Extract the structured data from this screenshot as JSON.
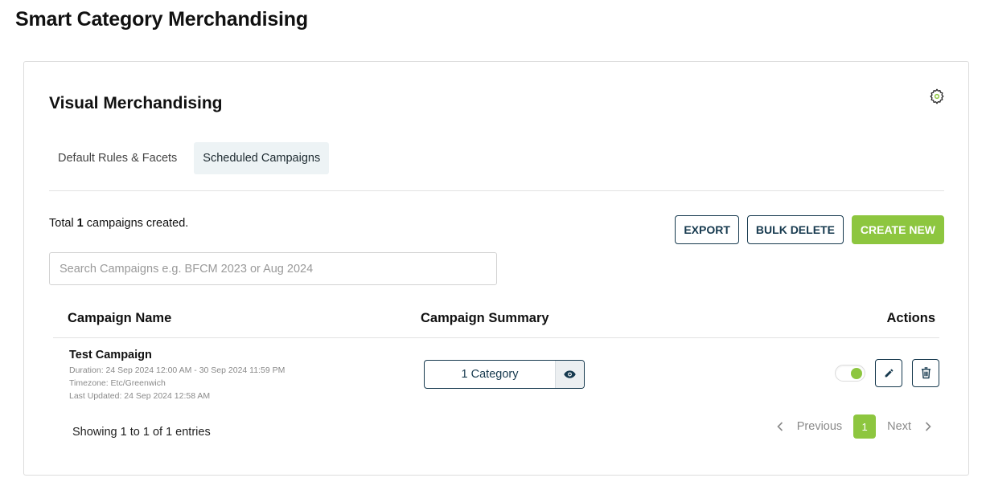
{
  "page": {
    "title": "Smart Category Merchandising"
  },
  "card": {
    "title": "Visual Merchandising",
    "settings_icon": "gear-icon"
  },
  "tabs": [
    {
      "label": "Default Rules & Facets",
      "active": false
    },
    {
      "label": "Scheduled Campaigns",
      "active": true
    }
  ],
  "summary": {
    "prefix": "Total",
    "count": "1",
    "suffix": "campaigns created."
  },
  "toolbar": {
    "export_label": "EXPORT",
    "bulk_delete_label": "BULK DELETE",
    "create_new_label": "CREATE NEW"
  },
  "search": {
    "placeholder": "Search Campaigns e.g. BFCM 2023 or Aug 2024",
    "value": ""
  },
  "table": {
    "columns": [
      "Campaign Name",
      "Campaign Summary",
      "Actions"
    ],
    "rows": [
      {
        "name": "Test Campaign",
        "duration": "Duration:  24 Sep 2024 12:00 AM - 30 Sep 2024 11:59 PM",
        "timezone": "Timezone:  Etc/Greenwich",
        "last_updated": "Last Updated:  24 Sep 2024 12:58 AM",
        "summary_label": "1 Category",
        "enabled": true
      }
    ]
  },
  "pagination": {
    "info": "Showing 1 to 1 of 1 entries",
    "previous_label": "Previous",
    "next_label": "Next",
    "current_page": "1"
  },
  "colors": {
    "accent": "#8dc63f",
    "primary_dark": "#16394e",
    "tab_active_bg": "#edf3f5"
  }
}
